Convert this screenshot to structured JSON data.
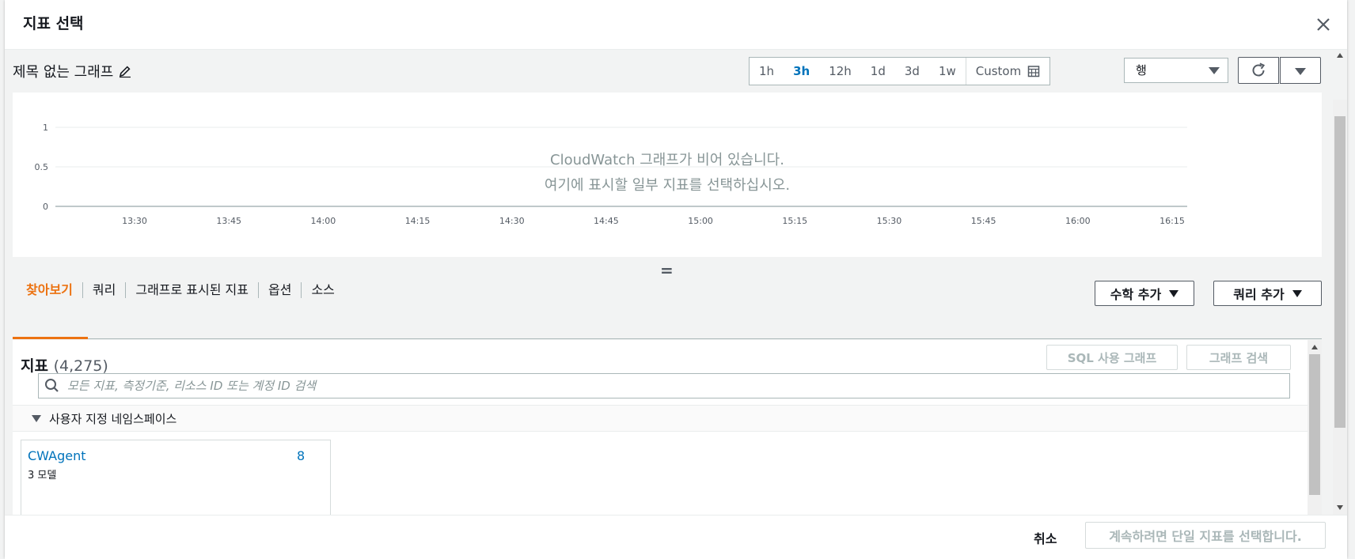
{
  "modal": {
    "title": "지표 선택"
  },
  "graph": {
    "title": "제목 없는 그래프",
    "empty_line1": "CloudWatch 그래프가 비어 있습니다.",
    "empty_line2": "여기에 표시할 일부 지표를 선택하십시오."
  },
  "time_range": {
    "options": [
      "1h",
      "3h",
      "12h",
      "1d",
      "3d",
      "1w"
    ],
    "selected": "3h",
    "custom_label": "Custom"
  },
  "view_select": {
    "value": "행"
  },
  "chart_data": {
    "type": "line",
    "title": "",
    "xlabel": "",
    "ylabel": "",
    "x_ticks": [
      "13:30",
      "13:45",
      "14:00",
      "14:15",
      "14:30",
      "14:45",
      "15:00",
      "15:15",
      "15:30",
      "15:45",
      "16:00",
      "16:15"
    ],
    "y_ticks": [
      "1",
      "0.5",
      "0"
    ],
    "ylim": [
      0,
      1
    ],
    "series": [],
    "grid": true
  },
  "tabs": [
    {
      "label": "찾아보기",
      "active": true
    },
    {
      "label": "쿼리",
      "active": false
    },
    {
      "label": "그래프로 표시된 지표",
      "active": false
    },
    {
      "label": "옵션",
      "active": false
    },
    {
      "label": "소스",
      "active": false
    }
  ],
  "actions": {
    "add_math": "수학 추가",
    "add_query": "쿼리 추가"
  },
  "metrics": {
    "heading": "지표",
    "count": "(4,275)",
    "sql_graph_button": "SQL 사용 그래프",
    "graph_search_button": "그래프 검색",
    "search_placeholder": "모든 지표, 측정기준, 리소스 ID 또는 계정 ID 검색",
    "section_label": "사용자 지정 네임스페이스",
    "namespaces": [
      {
        "name": "CWAgent",
        "count": "8",
        "sub": "3 모델"
      }
    ]
  },
  "footer": {
    "cancel": "취소",
    "confirm": "계속하려면 단일 지표를 선택합니다."
  },
  "colors": {
    "accent_orange": "#ec7211",
    "link_blue": "#0073bb",
    "border_gray": "#aab7b8"
  }
}
